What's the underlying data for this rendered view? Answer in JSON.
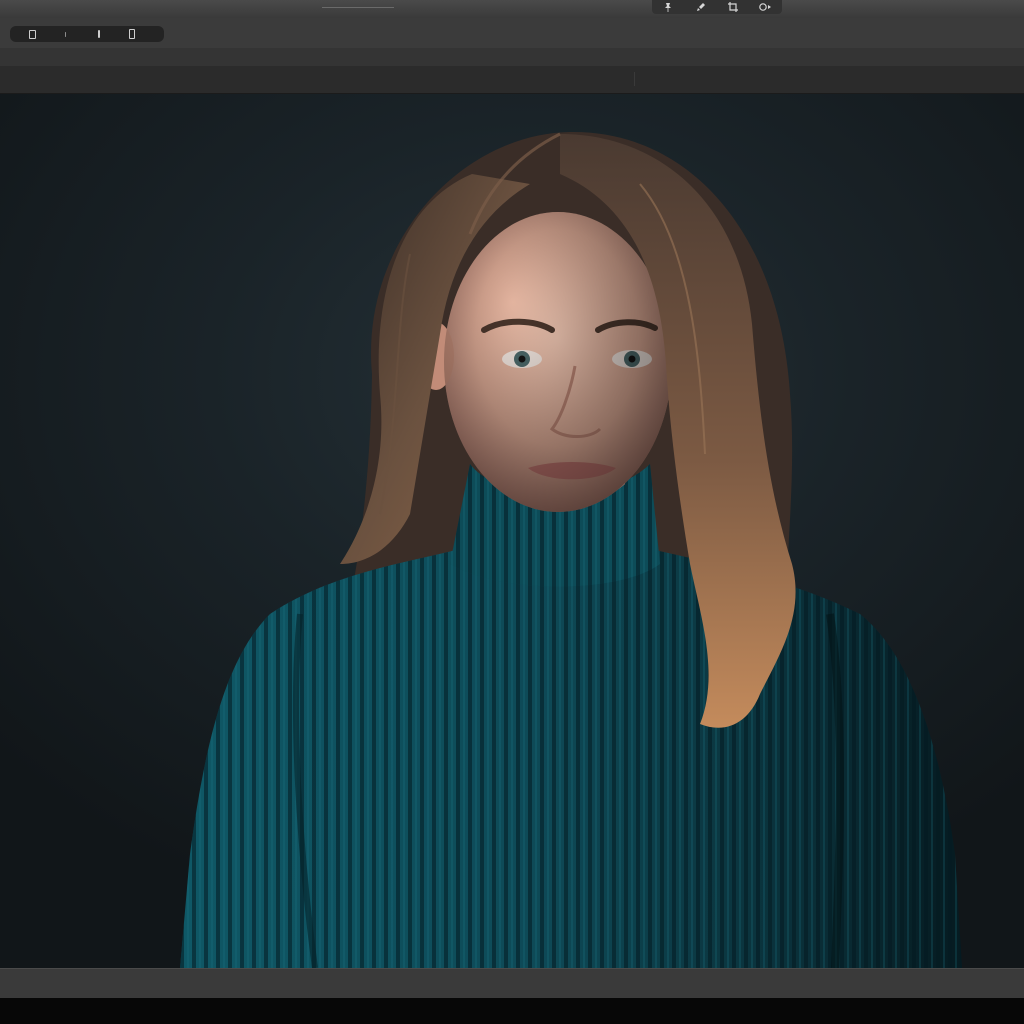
{
  "titlebar": {
    "app_title": "",
    "menu_text": "",
    "tools": [
      {
        "icon": "pin-icon"
      },
      {
        "icon": "brush-icon"
      },
      {
        "icon": "crop-icon"
      },
      {
        "icon": "share-icon"
      }
    ]
  },
  "toolbar": {
    "segments": [
      {
        "icon": "rotate-icon"
      },
      {
        "icon": "divider-icon"
      },
      {
        "icon": "text-cursor-icon"
      },
      {
        "icon": "document-icon"
      }
    ]
  },
  "tabs": {
    "left_label": "",
    "right_label": ""
  },
  "canvas": {
    "subject": "portrait photo",
    "colors": {
      "backdrop": "#1a2328",
      "sweater": "#0f4f5c",
      "hair": "#5a4333",
      "skin": "#e6b9a4"
    }
  },
  "colors": {
    "titlebar": "#3a3a3a",
    "toolbar": "#3b3b3b",
    "tabstrip": "#2b2b2b",
    "statusbar": "#3a3a3a"
  }
}
